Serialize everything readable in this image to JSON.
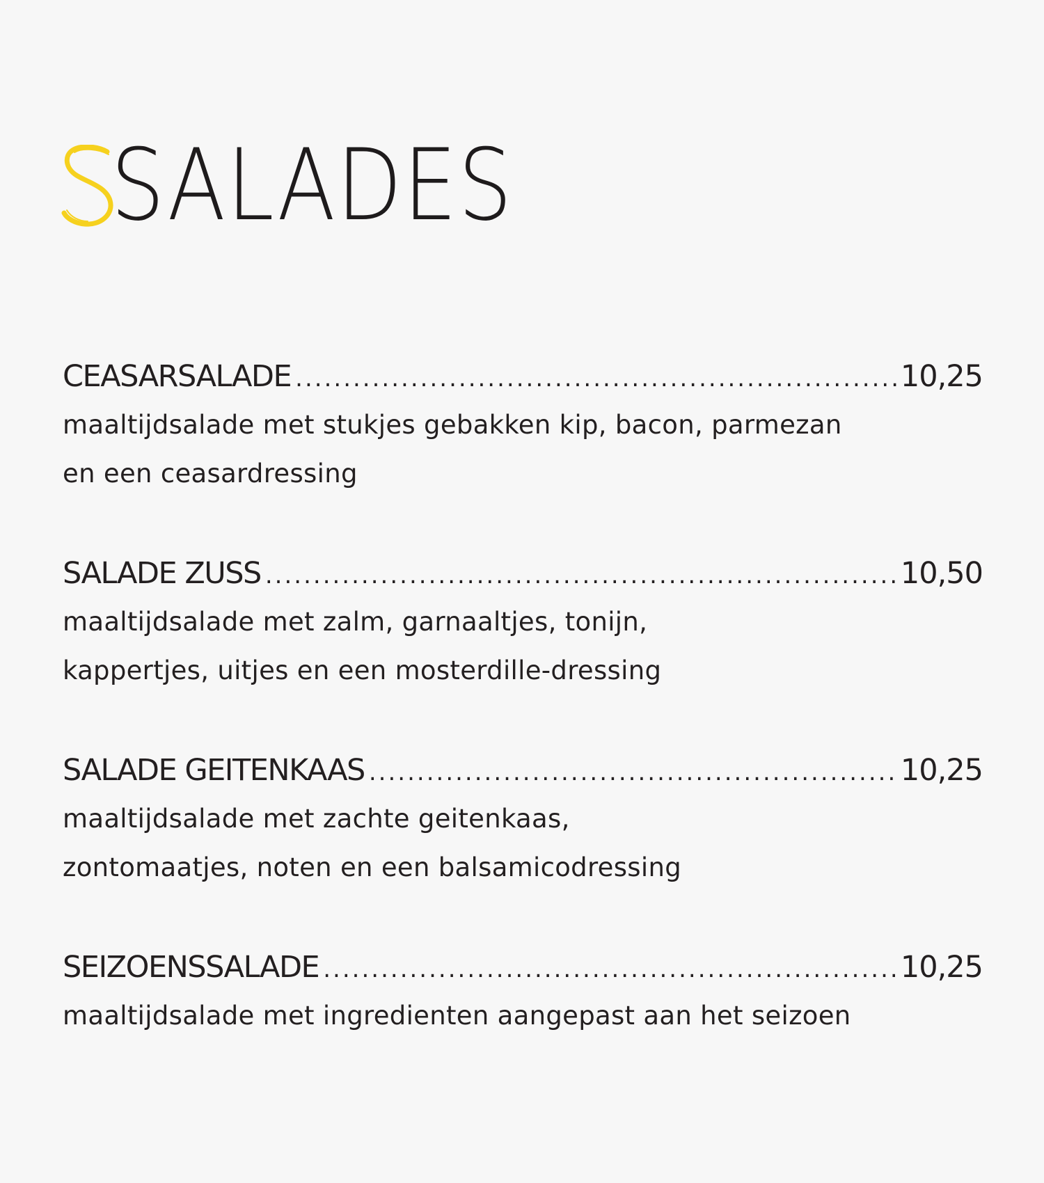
{
  "heading": {
    "title": "SALADES",
    "accent_color": "#f6d11e",
    "text_color": "#1e1b1c"
  },
  "items": [
    {
      "name": "CEASARSALADE",
      "price": "10,25",
      "description": [
        "maaltijdsalade met stukjes gebakken kip, bacon, parmezan",
        "en een ceasardressing"
      ]
    },
    {
      "name": "SALADE ZUSS",
      "price": "10,50",
      "description": [
        "maaltijdsalade met zalm, garnaaltjes, tonijn,",
        "kappertjes, uitjes en een mosterdille-dressing"
      ]
    },
    {
      "name": "SALADE GEITENKAAS",
      "price": "10,25",
      "description": [
        "maaltijdsalade met zachte geitenkaas,",
        "zontomaatjes, noten en een balsamicodressing"
      ]
    },
    {
      "name": "SEIZOENSSALADE",
      "price": "10,25",
      "description": [
        "maaltijdsalade met ingredienten aangepast aan het seizoen"
      ]
    }
  ]
}
